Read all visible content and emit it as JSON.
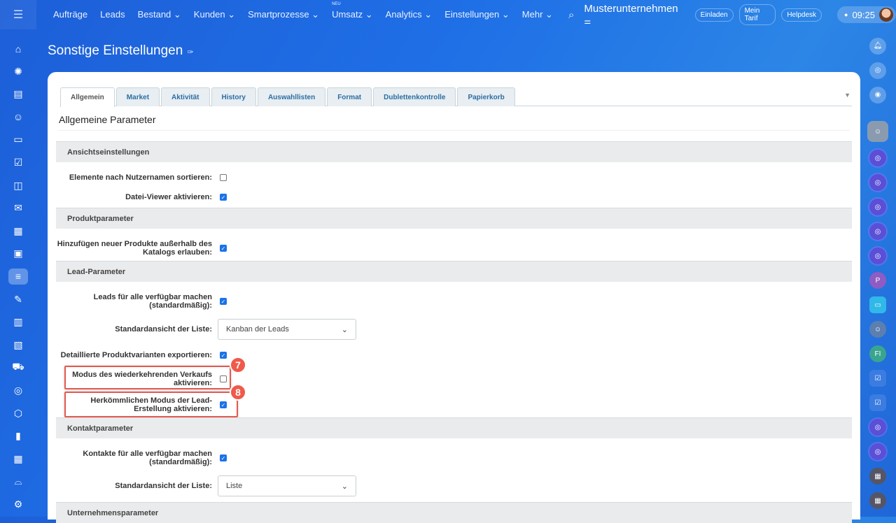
{
  "topbar": {
    "nav": [
      "Aufträge",
      "Leads",
      "Bestand",
      "Kunden",
      "Smartprozesse",
      "Umsatz",
      "Analytics",
      "Einstellungen",
      "Mehr"
    ],
    "neu_badge": "NEU",
    "company": "Musterunternehmen",
    "buttons": [
      "Einladen",
      "Mein Tarif",
      "Helpdesk"
    ],
    "time": "09:25"
  },
  "page": {
    "title": "Sonstige Einstellungen"
  },
  "tabs": [
    "Allgemein",
    "Market",
    "Aktivität",
    "History",
    "Auswahllisten",
    "Format",
    "Dublettenkontrolle",
    "Papierkorb"
  ],
  "subheading": "Allgemeine Parameter",
  "sections": {
    "view": "Ansichtseinstellungen",
    "product": "Produktparameter",
    "lead": "Lead-Parameter",
    "contact": "Kontaktparameter",
    "company": "Unternehmensparameter"
  },
  "fields": {
    "sort_users": {
      "label": "Elemente nach Nutzernamen sortieren:",
      "checked": false
    },
    "file_viewer": {
      "label": "Datei-Viewer aktivieren:",
      "checked": true
    },
    "add_products": {
      "label": "Hinzufügen neuer Produkte außerhalb des Katalogs erlauben:",
      "checked": true
    },
    "leads_available": {
      "label": "Leads für alle verfügbar machen (standardmäßig):",
      "checked": true
    },
    "lead_list_view": {
      "label": "Standardansicht der Liste:",
      "value": "Kanban der Leads"
    },
    "export_variants": {
      "label": "Detaillierte Produktvarianten exportieren:",
      "checked": true
    },
    "recurring_sales": {
      "label": "Modus des wiederkehrenden Verkaufs aktivieren:",
      "checked": false
    },
    "classic_lead": {
      "label": "Herkömmlichen Modus der Lead-Erstellung aktivieren:",
      "checked": true
    },
    "contacts_available": {
      "label": "Kontakte für alle verfügbar machen (standardmäßig):",
      "checked": true
    },
    "contact_list_view": {
      "label": "Standardansicht der Liste:",
      "value": "Liste"
    }
  },
  "annotations": [
    "7",
    "8"
  ],
  "rightbar": {
    "initials_p": "P",
    "initials_fi": "FI"
  }
}
